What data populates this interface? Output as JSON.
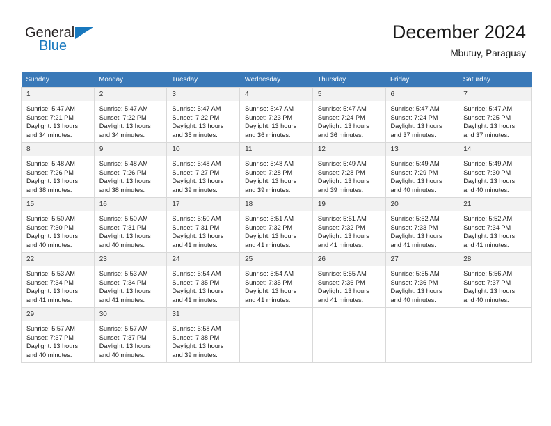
{
  "logo": {
    "word_top": "General",
    "word_bottom": "Blue",
    "triangle_color": "#1878be"
  },
  "header": {
    "title": "December 2024",
    "subtitle": "Mbutuy, Paraguay"
  },
  "colors": {
    "header_blue": "#3a79b8",
    "daynum_bg": "#f2f2f2",
    "grid_border": "#d9d9d9",
    "logo_blue": "#1878be"
  },
  "weekdays": [
    "Sunday",
    "Monday",
    "Tuesday",
    "Wednesday",
    "Thursday",
    "Friday",
    "Saturday"
  ],
  "weeks": [
    [
      {
        "day": "1",
        "sunrise": "Sunrise: 5:47 AM",
        "sunset": "Sunset: 7:21 PM",
        "daylight1": "Daylight: 13 hours",
        "daylight2": "and 34 minutes."
      },
      {
        "day": "2",
        "sunrise": "Sunrise: 5:47 AM",
        "sunset": "Sunset: 7:22 PM",
        "daylight1": "Daylight: 13 hours",
        "daylight2": "and 34 minutes."
      },
      {
        "day": "3",
        "sunrise": "Sunrise: 5:47 AM",
        "sunset": "Sunset: 7:22 PM",
        "daylight1": "Daylight: 13 hours",
        "daylight2": "and 35 minutes."
      },
      {
        "day": "4",
        "sunrise": "Sunrise: 5:47 AM",
        "sunset": "Sunset: 7:23 PM",
        "daylight1": "Daylight: 13 hours",
        "daylight2": "and 36 minutes."
      },
      {
        "day": "5",
        "sunrise": "Sunrise: 5:47 AM",
        "sunset": "Sunset: 7:24 PM",
        "daylight1": "Daylight: 13 hours",
        "daylight2": "and 36 minutes."
      },
      {
        "day": "6",
        "sunrise": "Sunrise: 5:47 AM",
        "sunset": "Sunset: 7:24 PM",
        "daylight1": "Daylight: 13 hours",
        "daylight2": "and 37 minutes."
      },
      {
        "day": "7",
        "sunrise": "Sunrise: 5:47 AM",
        "sunset": "Sunset: 7:25 PM",
        "daylight1": "Daylight: 13 hours",
        "daylight2": "and 37 minutes."
      }
    ],
    [
      {
        "day": "8",
        "sunrise": "Sunrise: 5:48 AM",
        "sunset": "Sunset: 7:26 PM",
        "daylight1": "Daylight: 13 hours",
        "daylight2": "and 38 minutes."
      },
      {
        "day": "9",
        "sunrise": "Sunrise: 5:48 AM",
        "sunset": "Sunset: 7:26 PM",
        "daylight1": "Daylight: 13 hours",
        "daylight2": "and 38 minutes."
      },
      {
        "day": "10",
        "sunrise": "Sunrise: 5:48 AM",
        "sunset": "Sunset: 7:27 PM",
        "daylight1": "Daylight: 13 hours",
        "daylight2": "and 39 minutes."
      },
      {
        "day": "11",
        "sunrise": "Sunrise: 5:48 AM",
        "sunset": "Sunset: 7:28 PM",
        "daylight1": "Daylight: 13 hours",
        "daylight2": "and 39 minutes."
      },
      {
        "day": "12",
        "sunrise": "Sunrise: 5:49 AM",
        "sunset": "Sunset: 7:28 PM",
        "daylight1": "Daylight: 13 hours",
        "daylight2": "and 39 minutes."
      },
      {
        "day": "13",
        "sunrise": "Sunrise: 5:49 AM",
        "sunset": "Sunset: 7:29 PM",
        "daylight1": "Daylight: 13 hours",
        "daylight2": "and 40 minutes."
      },
      {
        "day": "14",
        "sunrise": "Sunrise: 5:49 AM",
        "sunset": "Sunset: 7:30 PM",
        "daylight1": "Daylight: 13 hours",
        "daylight2": "and 40 minutes."
      }
    ],
    [
      {
        "day": "15",
        "sunrise": "Sunrise: 5:50 AM",
        "sunset": "Sunset: 7:30 PM",
        "daylight1": "Daylight: 13 hours",
        "daylight2": "and 40 minutes."
      },
      {
        "day": "16",
        "sunrise": "Sunrise: 5:50 AM",
        "sunset": "Sunset: 7:31 PM",
        "daylight1": "Daylight: 13 hours",
        "daylight2": "and 40 minutes."
      },
      {
        "day": "17",
        "sunrise": "Sunrise: 5:50 AM",
        "sunset": "Sunset: 7:31 PM",
        "daylight1": "Daylight: 13 hours",
        "daylight2": "and 41 minutes."
      },
      {
        "day": "18",
        "sunrise": "Sunrise: 5:51 AM",
        "sunset": "Sunset: 7:32 PM",
        "daylight1": "Daylight: 13 hours",
        "daylight2": "and 41 minutes."
      },
      {
        "day": "19",
        "sunrise": "Sunrise: 5:51 AM",
        "sunset": "Sunset: 7:32 PM",
        "daylight1": "Daylight: 13 hours",
        "daylight2": "and 41 minutes."
      },
      {
        "day": "20",
        "sunrise": "Sunrise: 5:52 AM",
        "sunset": "Sunset: 7:33 PM",
        "daylight1": "Daylight: 13 hours",
        "daylight2": "and 41 minutes."
      },
      {
        "day": "21",
        "sunrise": "Sunrise: 5:52 AM",
        "sunset": "Sunset: 7:34 PM",
        "daylight1": "Daylight: 13 hours",
        "daylight2": "and 41 minutes."
      }
    ],
    [
      {
        "day": "22",
        "sunrise": "Sunrise: 5:53 AM",
        "sunset": "Sunset: 7:34 PM",
        "daylight1": "Daylight: 13 hours",
        "daylight2": "and 41 minutes."
      },
      {
        "day": "23",
        "sunrise": "Sunrise: 5:53 AM",
        "sunset": "Sunset: 7:34 PM",
        "daylight1": "Daylight: 13 hours",
        "daylight2": "and 41 minutes."
      },
      {
        "day": "24",
        "sunrise": "Sunrise: 5:54 AM",
        "sunset": "Sunset: 7:35 PM",
        "daylight1": "Daylight: 13 hours",
        "daylight2": "and 41 minutes."
      },
      {
        "day": "25",
        "sunrise": "Sunrise: 5:54 AM",
        "sunset": "Sunset: 7:35 PM",
        "daylight1": "Daylight: 13 hours",
        "daylight2": "and 41 minutes."
      },
      {
        "day": "26",
        "sunrise": "Sunrise: 5:55 AM",
        "sunset": "Sunset: 7:36 PM",
        "daylight1": "Daylight: 13 hours",
        "daylight2": "and 41 minutes."
      },
      {
        "day": "27",
        "sunrise": "Sunrise: 5:55 AM",
        "sunset": "Sunset: 7:36 PM",
        "daylight1": "Daylight: 13 hours",
        "daylight2": "and 40 minutes."
      },
      {
        "day": "28",
        "sunrise": "Sunrise: 5:56 AM",
        "sunset": "Sunset: 7:37 PM",
        "daylight1": "Daylight: 13 hours",
        "daylight2": "and 40 minutes."
      }
    ],
    [
      {
        "day": "29",
        "sunrise": "Sunrise: 5:57 AM",
        "sunset": "Sunset: 7:37 PM",
        "daylight1": "Daylight: 13 hours",
        "daylight2": "and 40 minutes."
      },
      {
        "day": "30",
        "sunrise": "Sunrise: 5:57 AM",
        "sunset": "Sunset: 7:37 PM",
        "daylight1": "Daylight: 13 hours",
        "daylight2": "and 40 minutes."
      },
      {
        "day": "31",
        "sunrise": "Sunrise: 5:58 AM",
        "sunset": "Sunset: 7:38 PM",
        "daylight1": "Daylight: 13 hours",
        "daylight2": "and 39 minutes."
      },
      null,
      null,
      null,
      null
    ]
  ]
}
